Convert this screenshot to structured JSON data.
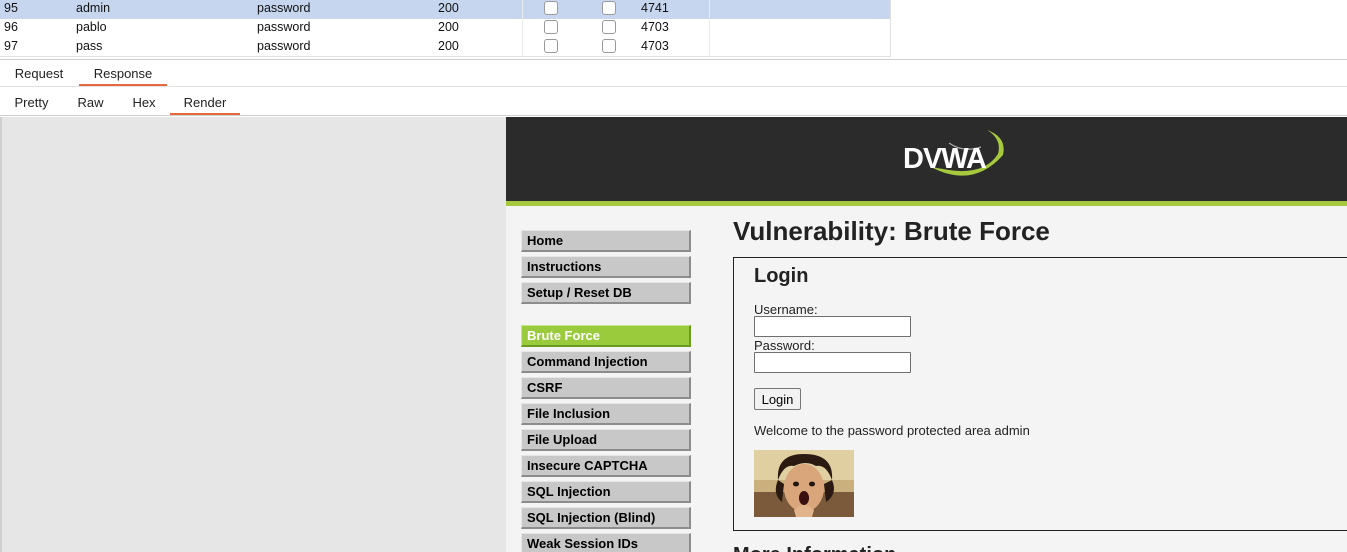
{
  "results": {
    "rows": [
      {
        "num": "95",
        "payload1": "admin",
        "payload2": "password",
        "status": "200",
        "length": "4741",
        "selected": true
      },
      {
        "num": "96",
        "payload1": "pablo",
        "payload2": "password",
        "status": "200",
        "length": "4703",
        "selected": false
      },
      {
        "num": "97",
        "payload1": "pass",
        "payload2": "password",
        "status": "200",
        "length": "4703",
        "selected": false
      }
    ]
  },
  "message_tabs": [
    {
      "label": "Request",
      "active": false
    },
    {
      "label": "Response",
      "active": true
    }
  ],
  "view_tabs": [
    {
      "label": "Pretty",
      "active": false
    },
    {
      "label": "Raw",
      "active": false
    },
    {
      "label": "Hex",
      "active": false
    },
    {
      "label": "Render",
      "active": true
    }
  ],
  "dvwa": {
    "logo_text": "DVWA",
    "menu": [
      {
        "label": "Home",
        "active": false
      },
      {
        "label": "Instructions",
        "active": false
      },
      {
        "label": "Setup / Reset DB",
        "active": false
      },
      {
        "label": "Brute Force",
        "active": true
      },
      {
        "label": "Command Injection",
        "active": false
      },
      {
        "label": "CSRF",
        "active": false
      },
      {
        "label": "File Inclusion",
        "active": false
      },
      {
        "label": "File Upload",
        "active": false
      },
      {
        "label": "Insecure CAPTCHA",
        "active": false
      },
      {
        "label": "SQL Injection",
        "active": false
      },
      {
        "label": "SQL Injection (Blind)",
        "active": false
      },
      {
        "label": "Weak Session IDs",
        "active": false
      }
    ],
    "page_title": "Vulnerability: Brute Force",
    "login": {
      "heading": "Login",
      "username_label": "Username:",
      "username_value": "",
      "password_label": "Password:",
      "password_value": "",
      "button_label": "Login",
      "welcome_text": "Welcome to the password protected area admin"
    },
    "more_info_heading": "More Information"
  },
  "colors": {
    "selected_row": "#c7d6ef",
    "tab_accent": "#e8683d",
    "dvwa_header": "#2b2b2b",
    "dvwa_green": "#9acb3c",
    "menu_gray": "#c8c8c8"
  }
}
